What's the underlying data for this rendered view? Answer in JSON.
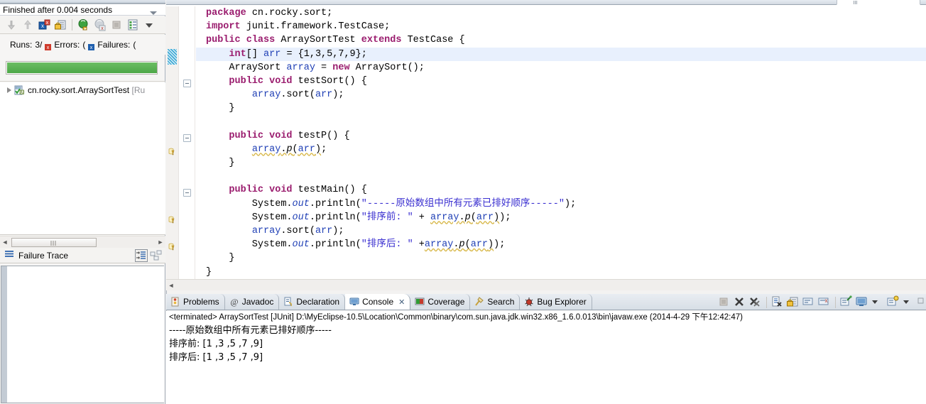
{
  "junit_view": {
    "title": "Finished after 0.004 seconds",
    "view_menu_icon": "chevron-down-icon",
    "toolbar": [
      {
        "name": "next-failure-icon",
        "label": "Next Failed Test"
      },
      {
        "name": "previous-failure-icon",
        "label": "Previous Failed Test"
      },
      {
        "name": "show-failures-only-icon",
        "label": "Show Failures Only"
      },
      {
        "name": "lock-scroll-icon",
        "label": "Scroll Lock"
      },
      {
        "name": "rerun-test-icon",
        "label": "Rerun Test"
      },
      {
        "name": "rerun-failed-icon",
        "label": "Rerun Test - Failures First"
      },
      {
        "name": "stop-icon",
        "label": "Stop JUnit Test Run"
      },
      {
        "name": "test-run-history-icon",
        "label": "Test Run History"
      },
      {
        "name": "view-menu-icon",
        "label": "View Menu"
      }
    ],
    "counters": {
      "runs_label": "Runs:",
      "runs_value": "3/",
      "errors_label": "Errors:",
      "errors_value": "(",
      "failures_label": "Failures:",
      "failures_value": "(",
      "errors_icon": "error-marker-icon",
      "failures_icon": "failure-marker-icon"
    },
    "progress": {
      "state_color": "#4da747",
      "percent": 100
    },
    "tree": [
      {
        "expander": "collapsed-arrow-icon",
        "icon": "test-suite-icon",
        "label": "cn.rocky.sort.ArraySortTest ",
        "suffix": "[Ru"
      }
    ],
    "hscroll": {
      "left_arrow": "scroll-left-arrow-icon",
      "right_arrow": "scroll-right-arrow-icon"
    },
    "failure_trace": {
      "icon": "stack-trace-icon",
      "label": "Failure Trace",
      "buttons": [
        {
          "name": "filter-stack-trace-button",
          "label": "Filter Stack Trace"
        },
        {
          "name": "compare-result-button",
          "label": "Compare Result"
        }
      ],
      "content": ""
    }
  },
  "editor": {
    "code_lines": [
      [
        {
          "t": "package",
          "c": "kw"
        },
        {
          "t": " cn.rocky.sort;",
          "c": "pl"
        }
      ],
      [
        {
          "t": "import",
          "c": "kw"
        },
        {
          "t": " junit.framework.TestCase;",
          "c": "pl"
        }
      ],
      [
        {
          "t": "public",
          "c": "kw"
        },
        {
          "t": " ",
          "c": "pl"
        },
        {
          "t": "class",
          "c": "kw"
        },
        {
          "t": " ArraySortTest ",
          "c": "pl"
        },
        {
          "t": "extends",
          "c": "kw"
        },
        {
          "t": " TestCase {",
          "c": "pl"
        }
      ],
      [
        {
          "t": "    ",
          "c": "pl"
        },
        {
          "t": "int",
          "c": "kw"
        },
        {
          "t": "[] ",
          "c": "pl"
        },
        {
          "t": "arr",
          "c": "fld"
        },
        {
          "t": " = {1,3,5,7,9};",
          "c": "pl"
        }
      ],
      [
        {
          "t": "    ArraySort ",
          "c": "pl"
        },
        {
          "t": "array",
          "c": "fld"
        },
        {
          "t": " = ",
          "c": "pl"
        },
        {
          "t": "new",
          "c": "kw"
        },
        {
          "t": " ArraySort();",
          "c": "pl"
        }
      ],
      [
        {
          "t": "    ",
          "c": "pl"
        },
        {
          "t": "public",
          "c": "kw"
        },
        {
          "t": " ",
          "c": "pl"
        },
        {
          "t": "void",
          "c": "kw"
        },
        {
          "t": " testSort() {",
          "c": "pl"
        }
      ],
      [
        {
          "t": "        ",
          "c": "pl"
        },
        {
          "t": "array",
          "c": "fld"
        },
        {
          "t": ".sort(",
          "c": "pl"
        },
        {
          "t": "arr",
          "c": "fld"
        },
        {
          "t": ");",
          "c": "pl"
        }
      ],
      [
        {
          "t": "    }",
          "c": "pl"
        }
      ],
      [
        {
          "t": "",
          "c": "pl"
        }
      ],
      [
        {
          "t": "    ",
          "c": "pl"
        },
        {
          "t": "public",
          "c": "kw"
        },
        {
          "t": " ",
          "c": "pl"
        },
        {
          "t": "void",
          "c": "kw"
        },
        {
          "t": " testP() {",
          "c": "pl"
        }
      ],
      [
        {
          "t": "        ",
          "c": "pl"
        },
        {
          "t": "array",
          "c": "fld warnu"
        },
        {
          "t": ".",
          "c": "pl warnu"
        },
        {
          "t": "p",
          "c": "pl warnu mi"
        },
        {
          "t": "(",
          "c": "pl warnu"
        },
        {
          "t": "arr",
          "c": "fld warnu"
        },
        {
          "t": ")",
          "c": "pl warnu"
        },
        {
          "t": ";",
          "c": "pl"
        }
      ],
      [
        {
          "t": "    }",
          "c": "pl"
        }
      ],
      [
        {
          "t": "",
          "c": "pl"
        }
      ],
      [
        {
          "t": "    ",
          "c": "pl"
        },
        {
          "t": "public",
          "c": "kw"
        },
        {
          "t": " ",
          "c": "pl"
        },
        {
          "t": "void",
          "c": "kw"
        },
        {
          "t": " testMain() {",
          "c": "pl"
        }
      ],
      [
        {
          "t": "        System.",
          "c": "pl"
        },
        {
          "t": "out",
          "c": "sfld"
        },
        {
          "t": ".println(",
          "c": "pl"
        },
        {
          "t": "\"-----原始数组中所有元素已排好顺序-----\"",
          "c": "str"
        },
        {
          "t": ");",
          "c": "pl"
        }
      ],
      [
        {
          "t": "        System.",
          "c": "pl"
        },
        {
          "t": "out",
          "c": "sfld"
        },
        {
          "t": ".println(",
          "c": "pl"
        },
        {
          "t": "\"排序前: \"",
          "c": "str"
        },
        {
          "t": " + ",
          "c": "pl"
        },
        {
          "t": "array",
          "c": "fld warnu"
        },
        {
          "t": ".",
          "c": "pl warnu"
        },
        {
          "t": "p",
          "c": "pl warnu mi"
        },
        {
          "t": "(",
          "c": "pl warnu"
        },
        {
          "t": "arr",
          "c": "fld warnu"
        },
        {
          "t": ")",
          "c": "pl warnu"
        },
        {
          "t": ");",
          "c": "pl"
        }
      ],
      [
        {
          "t": "        ",
          "c": "pl"
        },
        {
          "t": "array",
          "c": "fld"
        },
        {
          "t": ".sort(",
          "c": "pl"
        },
        {
          "t": "arr",
          "c": "fld"
        },
        {
          "t": ");",
          "c": "pl"
        }
      ],
      [
        {
          "t": "        System.",
          "c": "pl"
        },
        {
          "t": "out",
          "c": "sfld"
        },
        {
          "t": ".println(",
          "c": "pl"
        },
        {
          "t": "\"排序后: \"",
          "c": "str"
        },
        {
          "t": " +",
          "c": "pl"
        },
        {
          "t": "array",
          "c": "fld warnu"
        },
        {
          "t": ".",
          "c": "pl warnu"
        },
        {
          "t": "p",
          "c": "pl warnu mi"
        },
        {
          "t": "(",
          "c": "pl warnu"
        },
        {
          "t": "arr",
          "c": "fld warnu"
        },
        {
          "t": ")",
          "c": "pl warnu"
        },
        {
          "t": ");",
          "c": "pl"
        }
      ],
      [
        {
          "t": "    }",
          "c": "pl"
        }
      ],
      [
        {
          "t": "}",
          "c": "pl"
        }
      ]
    ],
    "highlighted_line_index": 3,
    "change_marker": {
      "name": "changed-lines-marker",
      "color": "#3fa9d4",
      "line_index": 3
    },
    "fold_markers": [
      5,
      9,
      13
    ],
    "warning_markers": [
      10,
      15,
      17
    ],
    "hscroll": {
      "left_arrow": "scroll-left-arrow-icon"
    }
  },
  "bottom_panel": {
    "tabs": [
      {
        "label": "Problems",
        "icon": "problems-icon",
        "active": false,
        "closable": false
      },
      {
        "label": "Javadoc",
        "icon": "javadoc-at-icon",
        "active": false,
        "closable": false
      },
      {
        "label": "Declaration",
        "icon": "declaration-icon",
        "active": false,
        "closable": false
      },
      {
        "label": "Console",
        "icon": "console-icon",
        "active": true,
        "closable": true,
        "close_glyph": "✕"
      },
      {
        "label": "Coverage",
        "icon": "coverage-icon",
        "active": false,
        "closable": false
      },
      {
        "label": "Search",
        "icon": "search-broom-icon",
        "active": false,
        "closable": false
      },
      {
        "label": "Bug Explorer",
        "icon": "bug-explorer-icon",
        "active": false,
        "closable": false
      }
    ],
    "toolbar": [
      {
        "name": "terminate-button",
        "label": "Terminate"
      },
      {
        "name": "remove-launch-button",
        "label": "Remove Launch"
      },
      {
        "name": "remove-all-terminated-button",
        "label": "Remove All Terminated Launches"
      },
      {
        "name": "clear-console-button",
        "label": "Clear Console"
      },
      {
        "name": "scroll-lock-button",
        "label": "Scroll Lock"
      },
      {
        "name": "word-wrap-button",
        "label": "Word Wrap"
      },
      {
        "name": "show-console-on-output-button",
        "label": "Show Console When Output Changes"
      },
      {
        "name": "pin-console-button",
        "label": "Pin Console"
      },
      {
        "name": "display-selected-console-button",
        "label": "Display Selected Console"
      },
      {
        "name": "display-console-dropdown",
        "label": "Display Selected Console Menu"
      },
      {
        "name": "open-console-button",
        "label": "Open Console"
      },
      {
        "name": "open-console-dropdown",
        "label": "Open Console Menu"
      },
      {
        "name": "view-menu-button",
        "label": "View Menu"
      }
    ],
    "console": {
      "header": "<terminated> ArraySortTest [JUnit] D:\\MyEclipse-10.5\\Location\\Common\\binary\\com.sun.java.jdk.win32.x86_1.6.0.013\\bin\\javaw.exe (2014-4-29 下午12:42:47)",
      "lines": [
        "-----原始数组中所有元素已排好顺序-----",
        "排序前: [1 ,3 ,5 ,7 ,9]",
        "排序后: [1 ,3 ,5 ,7 ,9]"
      ]
    }
  }
}
